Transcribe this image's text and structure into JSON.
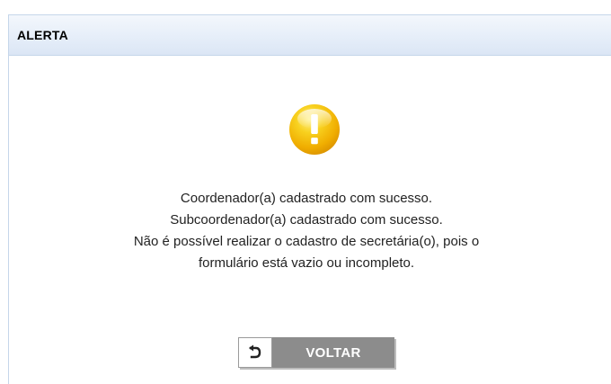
{
  "header": {
    "title": "ALERTA"
  },
  "alert": {
    "icon": "warning-exclamation-icon",
    "icon_text": "!",
    "colors": {
      "icon_fill": "#f2b705",
      "icon_highlight": "#ffe66b"
    },
    "messages": [
      "Coordenador(a) cadastrado com sucesso.",
      "Subcoordenador(a) cadastrado com sucesso.",
      "Não é possível realizar o cadastro de secretária(o), pois o",
      "formulário está vazio ou incompleto."
    ]
  },
  "actions": {
    "back_label": "VOLTAR",
    "back_icon": "return-arrow-icon"
  }
}
